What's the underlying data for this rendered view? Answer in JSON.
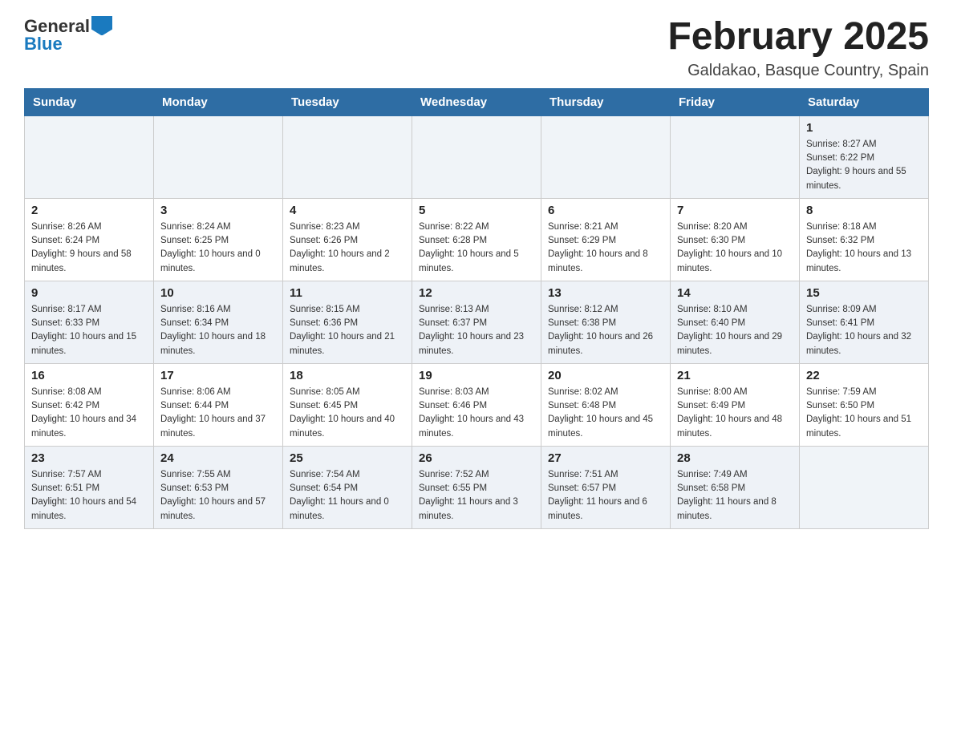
{
  "header": {
    "logo_general": "General",
    "logo_blue": "Blue",
    "title": "February 2025",
    "location": "Galdakao, Basque Country, Spain"
  },
  "weekdays": [
    "Sunday",
    "Monday",
    "Tuesday",
    "Wednesday",
    "Thursday",
    "Friday",
    "Saturday"
  ],
  "weeks": [
    {
      "days": [
        {
          "num": "",
          "info": ""
        },
        {
          "num": "",
          "info": ""
        },
        {
          "num": "",
          "info": ""
        },
        {
          "num": "",
          "info": ""
        },
        {
          "num": "",
          "info": ""
        },
        {
          "num": "",
          "info": ""
        },
        {
          "num": "1",
          "info": "Sunrise: 8:27 AM\nSunset: 6:22 PM\nDaylight: 9 hours and 55 minutes."
        }
      ]
    },
    {
      "days": [
        {
          "num": "2",
          "info": "Sunrise: 8:26 AM\nSunset: 6:24 PM\nDaylight: 9 hours and 58 minutes."
        },
        {
          "num": "3",
          "info": "Sunrise: 8:24 AM\nSunset: 6:25 PM\nDaylight: 10 hours and 0 minutes."
        },
        {
          "num": "4",
          "info": "Sunrise: 8:23 AM\nSunset: 6:26 PM\nDaylight: 10 hours and 2 minutes."
        },
        {
          "num": "5",
          "info": "Sunrise: 8:22 AM\nSunset: 6:28 PM\nDaylight: 10 hours and 5 minutes."
        },
        {
          "num": "6",
          "info": "Sunrise: 8:21 AM\nSunset: 6:29 PM\nDaylight: 10 hours and 8 minutes."
        },
        {
          "num": "7",
          "info": "Sunrise: 8:20 AM\nSunset: 6:30 PM\nDaylight: 10 hours and 10 minutes."
        },
        {
          "num": "8",
          "info": "Sunrise: 8:18 AM\nSunset: 6:32 PM\nDaylight: 10 hours and 13 minutes."
        }
      ]
    },
    {
      "days": [
        {
          "num": "9",
          "info": "Sunrise: 8:17 AM\nSunset: 6:33 PM\nDaylight: 10 hours and 15 minutes."
        },
        {
          "num": "10",
          "info": "Sunrise: 8:16 AM\nSunset: 6:34 PM\nDaylight: 10 hours and 18 minutes."
        },
        {
          "num": "11",
          "info": "Sunrise: 8:15 AM\nSunset: 6:36 PM\nDaylight: 10 hours and 21 minutes."
        },
        {
          "num": "12",
          "info": "Sunrise: 8:13 AM\nSunset: 6:37 PM\nDaylight: 10 hours and 23 minutes."
        },
        {
          "num": "13",
          "info": "Sunrise: 8:12 AM\nSunset: 6:38 PM\nDaylight: 10 hours and 26 minutes."
        },
        {
          "num": "14",
          "info": "Sunrise: 8:10 AM\nSunset: 6:40 PM\nDaylight: 10 hours and 29 minutes."
        },
        {
          "num": "15",
          "info": "Sunrise: 8:09 AM\nSunset: 6:41 PM\nDaylight: 10 hours and 32 minutes."
        }
      ]
    },
    {
      "days": [
        {
          "num": "16",
          "info": "Sunrise: 8:08 AM\nSunset: 6:42 PM\nDaylight: 10 hours and 34 minutes."
        },
        {
          "num": "17",
          "info": "Sunrise: 8:06 AM\nSunset: 6:44 PM\nDaylight: 10 hours and 37 minutes."
        },
        {
          "num": "18",
          "info": "Sunrise: 8:05 AM\nSunset: 6:45 PM\nDaylight: 10 hours and 40 minutes."
        },
        {
          "num": "19",
          "info": "Sunrise: 8:03 AM\nSunset: 6:46 PM\nDaylight: 10 hours and 43 minutes."
        },
        {
          "num": "20",
          "info": "Sunrise: 8:02 AM\nSunset: 6:48 PM\nDaylight: 10 hours and 45 minutes."
        },
        {
          "num": "21",
          "info": "Sunrise: 8:00 AM\nSunset: 6:49 PM\nDaylight: 10 hours and 48 minutes."
        },
        {
          "num": "22",
          "info": "Sunrise: 7:59 AM\nSunset: 6:50 PM\nDaylight: 10 hours and 51 minutes."
        }
      ]
    },
    {
      "days": [
        {
          "num": "23",
          "info": "Sunrise: 7:57 AM\nSunset: 6:51 PM\nDaylight: 10 hours and 54 minutes."
        },
        {
          "num": "24",
          "info": "Sunrise: 7:55 AM\nSunset: 6:53 PM\nDaylight: 10 hours and 57 minutes."
        },
        {
          "num": "25",
          "info": "Sunrise: 7:54 AM\nSunset: 6:54 PM\nDaylight: 11 hours and 0 minutes."
        },
        {
          "num": "26",
          "info": "Sunrise: 7:52 AM\nSunset: 6:55 PM\nDaylight: 11 hours and 3 minutes."
        },
        {
          "num": "27",
          "info": "Sunrise: 7:51 AM\nSunset: 6:57 PM\nDaylight: 11 hours and 6 minutes."
        },
        {
          "num": "28",
          "info": "Sunrise: 7:49 AM\nSunset: 6:58 PM\nDaylight: 11 hours and 8 minutes."
        },
        {
          "num": "",
          "info": ""
        }
      ]
    }
  ]
}
